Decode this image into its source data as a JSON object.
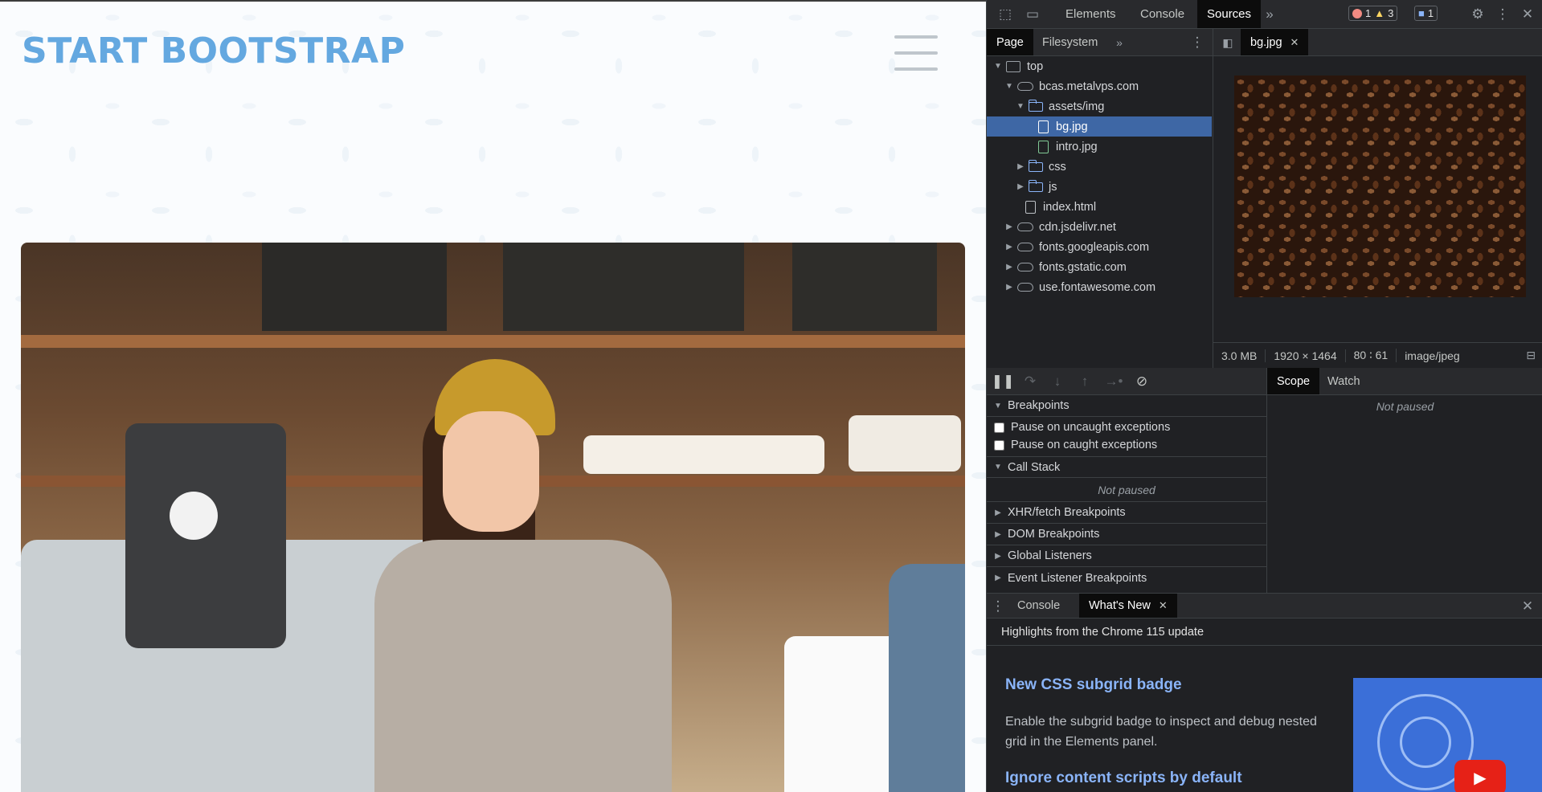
{
  "site": {
    "brand": "START BOOTSTRAP"
  },
  "devtools": {
    "top_tabs": [
      "Elements",
      "Console",
      "Sources"
    ],
    "active_top_tab": "Sources",
    "more_tabs_glyph": "»",
    "counters": {
      "errors": "1",
      "warnings": "3",
      "messages": "1"
    },
    "navigator_tabs": [
      "Page",
      "Filesystem"
    ],
    "open_file_tab": "bg.jpg",
    "tree": [
      {
        "label": "top",
        "kind": "frame",
        "depth": 0,
        "arrow": "▼"
      },
      {
        "label": "bcas.metalvps.com",
        "kind": "cloud",
        "depth": 1,
        "arrow": "▼"
      },
      {
        "label": "assets/img",
        "kind": "folder",
        "depth": 2,
        "arrow": "▼"
      },
      {
        "label": "bg.jpg",
        "kind": "file-white",
        "depth": 3,
        "arrow": "",
        "selected": true
      },
      {
        "label": "intro.jpg",
        "kind": "file-img",
        "depth": 3,
        "arrow": ""
      },
      {
        "label": "css",
        "kind": "folder",
        "depth": 2,
        "arrow": "▶"
      },
      {
        "label": "js",
        "kind": "folder",
        "depth": 2,
        "arrow": "▶"
      },
      {
        "label": "index.html",
        "kind": "file",
        "depth": 2,
        "arrow": ""
      },
      {
        "label": "cdn.jsdelivr.net",
        "kind": "cloud",
        "depth": 1,
        "arrow": "▶"
      },
      {
        "label": "fonts.googleapis.com",
        "kind": "cloud",
        "depth": 1,
        "arrow": "▶"
      },
      {
        "label": "fonts.gstatic.com",
        "kind": "cloud",
        "depth": 1,
        "arrow": "▶"
      },
      {
        "label": "use.fontawesome.com",
        "kind": "cloud",
        "depth": 1,
        "arrow": "▶"
      }
    ],
    "image_info": {
      "size": "3.0 MB",
      "dimensions": "1920 × 1464",
      "ratio": "80 ∶ 61",
      "mime": "image/jpeg"
    },
    "debug_tabs": [
      "Scope",
      "Watch"
    ],
    "scope_status": "Not paused",
    "sections": {
      "breakpoints": "Breakpoints",
      "pause_uncaught": "Pause on uncaught exceptions",
      "pause_caught": "Pause on caught exceptions",
      "call_stack": "Call Stack",
      "call_stack_status": "Not paused",
      "xhr": "XHR/fetch Breakpoints",
      "dom": "DOM Breakpoints",
      "global": "Global Listeners",
      "event": "Event Listener Breakpoints"
    },
    "drawer": {
      "tabs": [
        "Console",
        "What's New"
      ],
      "highlights": "Highlights from the Chrome 115 update",
      "feature1_title": "New CSS subgrid badge",
      "feature1_desc": "Enable the subgrid badge to inspect and debug nested grid in the Elements panel.",
      "feature2_title": "Ignore content scripts by default"
    },
    "colors": {
      "background": "#202124",
      "selection": "#3e67a5",
      "link": "#8ab4f8",
      "brand": "#64a8e0"
    }
  }
}
